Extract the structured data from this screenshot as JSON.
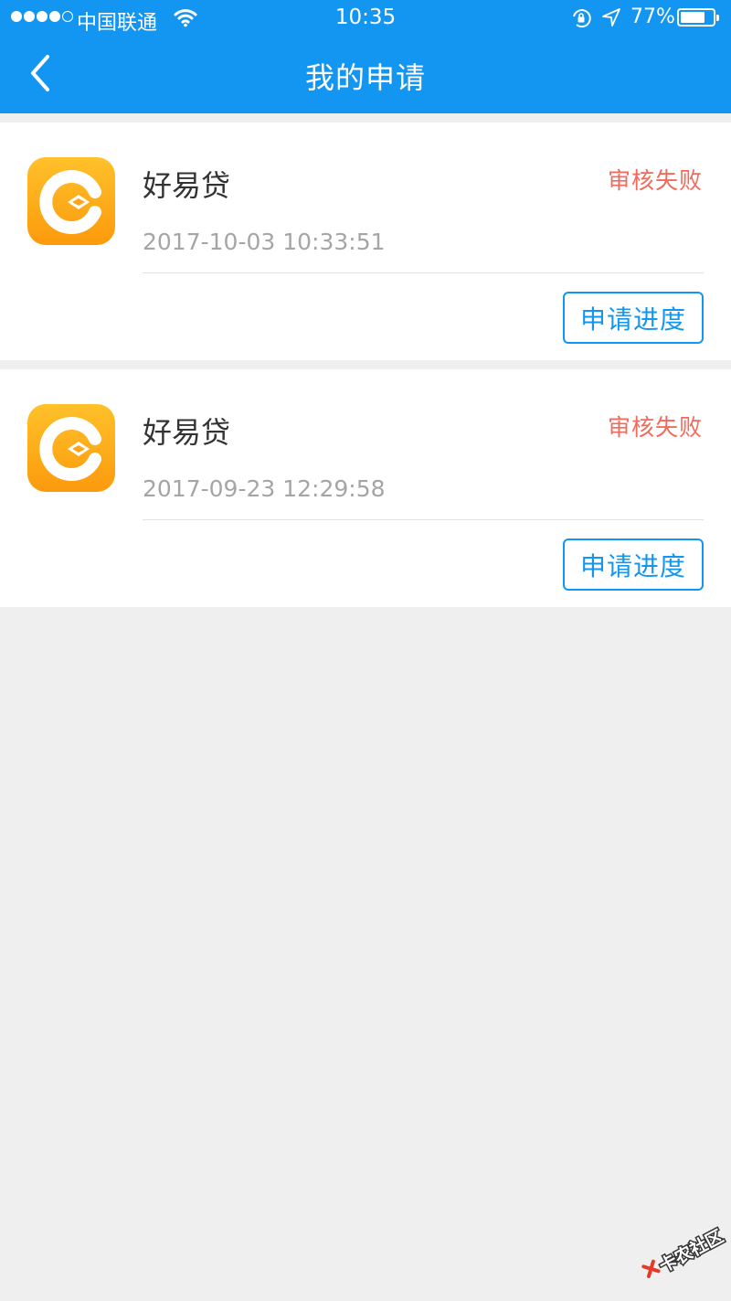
{
  "status_bar": {
    "carrier": "中国联通",
    "time": "10:35",
    "battery_percent": "77%",
    "battery_level": 0.77
  },
  "header": {
    "title": "我的申请",
    "background_color": "#1296f2"
  },
  "applications": [
    {
      "app_name": "好易贷",
      "status": "审核失败",
      "timestamp": "2017-10-03 10:33:51",
      "action_label": "申请进度"
    },
    {
      "app_name": "好易贷",
      "status": "审核失败",
      "timestamp": "2017-09-23 12:29:58",
      "action_label": "申请进度"
    }
  ],
  "colors": {
    "accent": "#1296f2",
    "status_failed": "#f46a5a",
    "icon_orange": "#fda51a"
  },
  "icons": {
    "back": "chevron-left-icon",
    "app": "haoyidai-logo-icon",
    "wifi": "wifi-icon",
    "lock": "orientation-lock-icon",
    "location": "location-arrow-icon",
    "battery": "battery-icon"
  },
  "watermark": {
    "text": "卡农社区"
  }
}
